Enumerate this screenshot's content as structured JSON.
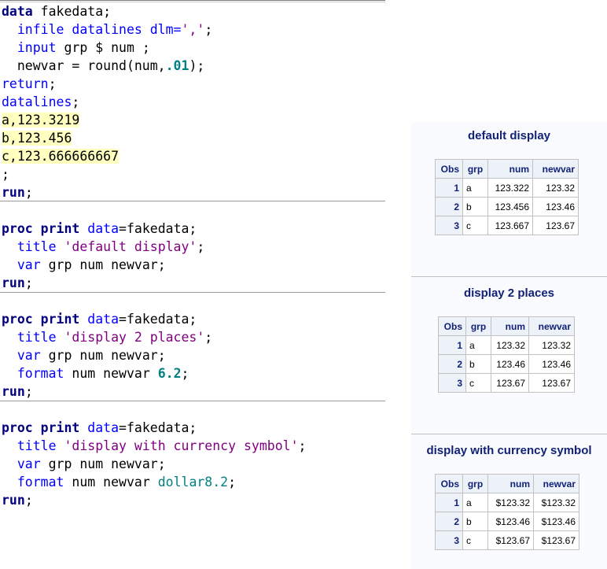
{
  "editor": {
    "program": [
      {
        "segments": [
          {
            "t": "data",
            "c": "kw"
          },
          {
            "t": " fakedata;",
            "c": "plain"
          }
        ]
      },
      {
        "segments": [
          {
            "t": "  ",
            "c": "plain"
          },
          {
            "t": "infile datalines dlm=",
            "c": "bl"
          },
          {
            "t": "','",
            "c": "str"
          },
          {
            "t": ";",
            "c": "plain"
          }
        ]
      },
      {
        "segments": [
          {
            "t": "  ",
            "c": "plain"
          },
          {
            "t": "input",
            "c": "bl"
          },
          {
            "t": " grp $ num ;",
            "c": "plain"
          }
        ]
      },
      {
        "segments": [
          {
            "t": "  newvar = round(num,",
            "c": "plain"
          },
          {
            "t": ".01",
            "c": "num"
          },
          {
            "t": ");",
            "c": "plain"
          }
        ]
      },
      {
        "segments": [
          {
            "t": "return",
            "c": "bl"
          },
          {
            "t": ";",
            "c": "plain"
          }
        ]
      },
      {
        "segments": [
          {
            "t": "datalines",
            "c": "bl"
          },
          {
            "t": ";",
            "c": "plain"
          }
        ]
      },
      {
        "segments": [
          {
            "t": "a,123.3219",
            "c": "data"
          }
        ]
      },
      {
        "segments": [
          {
            "t": "b,123.456",
            "c": "data"
          }
        ]
      },
      {
        "segments": [
          {
            "t": "c,123.666666667",
            "c": "data"
          }
        ]
      },
      {
        "segments": [
          {
            "t": ";",
            "c": "plain"
          }
        ]
      },
      {
        "segments": [
          {
            "t": "run",
            "c": "kw"
          },
          {
            "t": ";",
            "c": "plain"
          }
        ]
      },
      {
        "segments": []
      },
      {
        "segments": [
          {
            "t": "proc print",
            "c": "kw"
          },
          {
            "t": " ",
            "c": "plain"
          },
          {
            "t": "data",
            "c": "bl"
          },
          {
            "t": "=fakedata;",
            "c": "plain"
          }
        ]
      },
      {
        "segments": [
          {
            "t": "  ",
            "c": "plain"
          },
          {
            "t": "title",
            "c": "bl"
          },
          {
            "t": " ",
            "c": "plain"
          },
          {
            "t": "'default display'",
            "c": "str"
          },
          {
            "t": ";",
            "c": "plain"
          }
        ]
      },
      {
        "segments": [
          {
            "t": "  ",
            "c": "plain"
          },
          {
            "t": "var",
            "c": "bl"
          },
          {
            "t": " grp num newvar;",
            "c": "plain"
          }
        ]
      },
      {
        "segments": [
          {
            "t": "run",
            "c": "kw"
          },
          {
            "t": ";",
            "c": "plain"
          }
        ]
      },
      {
        "segments": []
      },
      {
        "segments": [
          {
            "t": "proc print",
            "c": "kw"
          },
          {
            "t": " ",
            "c": "plain"
          },
          {
            "t": "data",
            "c": "bl"
          },
          {
            "t": "=fakedata;",
            "c": "plain"
          }
        ]
      },
      {
        "segments": [
          {
            "t": "  ",
            "c": "plain"
          },
          {
            "t": "title",
            "c": "bl"
          },
          {
            "t": " ",
            "c": "plain"
          },
          {
            "t": "'display 2 places'",
            "c": "str"
          },
          {
            "t": ";",
            "c": "plain"
          }
        ]
      },
      {
        "segments": [
          {
            "t": "  ",
            "c": "plain"
          },
          {
            "t": "var",
            "c": "bl"
          },
          {
            "t": " grp num newvar;",
            "c": "plain"
          }
        ]
      },
      {
        "segments": [
          {
            "t": "  ",
            "c": "plain"
          },
          {
            "t": "format",
            "c": "bl"
          },
          {
            "t": " num newvar ",
            "c": "plain"
          },
          {
            "t": "6.2",
            "c": "num"
          },
          {
            "t": ";",
            "c": "plain"
          }
        ]
      },
      {
        "segments": [
          {
            "t": "run",
            "c": "kw"
          },
          {
            "t": ";",
            "c": "plain"
          }
        ]
      },
      {
        "segments": []
      },
      {
        "segments": [
          {
            "t": "proc print",
            "c": "kw"
          },
          {
            "t": " ",
            "c": "plain"
          },
          {
            "t": "data",
            "c": "bl"
          },
          {
            "t": "=fakedata;",
            "c": "plain"
          }
        ]
      },
      {
        "segments": [
          {
            "t": "  ",
            "c": "plain"
          },
          {
            "t": "title",
            "c": "bl"
          },
          {
            "t": " ",
            "c": "plain"
          },
          {
            "t": "'display with currency symbol'",
            "c": "str"
          },
          {
            "t": ";",
            "c": "plain"
          }
        ]
      },
      {
        "segments": [
          {
            "t": "  ",
            "c": "plain"
          },
          {
            "t": "var",
            "c": "bl"
          },
          {
            "t": " grp num newvar;",
            "c": "plain"
          }
        ]
      },
      {
        "segments": [
          {
            "t": "  ",
            "c": "plain"
          },
          {
            "t": "format",
            "c": "bl"
          },
          {
            "t": " num newvar ",
            "c": "plain"
          },
          {
            "t": "dollar8.2",
            "c": "fmt"
          },
          {
            "t": ";",
            "c": "plain"
          }
        ]
      },
      {
        "segments": [
          {
            "t": "run",
            "c": "kw"
          },
          {
            "t": ";",
            "c": "plain"
          }
        ]
      }
    ]
  },
  "results": [
    {
      "title": "default display",
      "headers": [
        "Obs",
        "grp",
        "num",
        "newvar"
      ],
      "rows": [
        [
          "1",
          "a",
          "123.322",
          "123.32"
        ],
        [
          "2",
          "b",
          "123.456",
          "123.46"
        ],
        [
          "3",
          "c",
          "123.667",
          "123.67"
        ]
      ]
    },
    {
      "title": "display 2 places",
      "headers": [
        "Obs",
        "grp",
        "num",
        "newvar"
      ],
      "rows": [
        [
          "1",
          "a",
          "123.32",
          "123.32"
        ],
        [
          "2",
          "b",
          "123.46",
          "123.46"
        ],
        [
          "3",
          "c",
          "123.67",
          "123.67"
        ]
      ]
    },
    {
      "title": "display with currency symbol",
      "headers": [
        "Obs",
        "grp",
        "num",
        "newvar"
      ],
      "rows": [
        [
          "1",
          "a",
          "$123.32",
          "$123.32"
        ],
        [
          "2",
          "b",
          "$123.46",
          "$123.46"
        ],
        [
          "3",
          "c",
          "$123.67",
          "$123.67"
        ]
      ]
    }
  ]
}
